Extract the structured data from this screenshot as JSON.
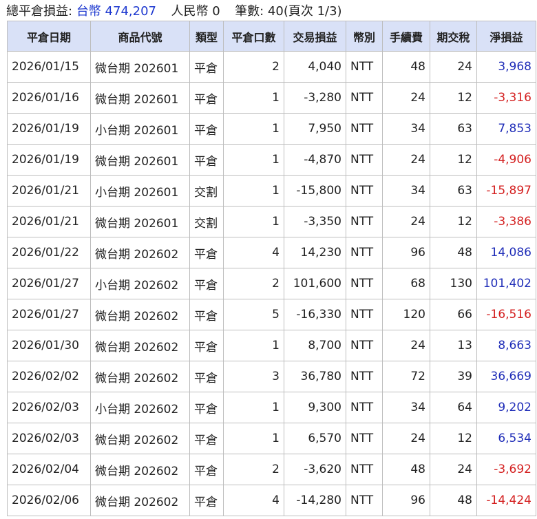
{
  "summary": {
    "label": "總平倉損益:",
    "twd_label": "台幣",
    "twd_value": "474,207",
    "rmb_label": "人民幣",
    "rmb_value": "0",
    "count_label": "筆數:",
    "count_value": "40(頁次 1/3)"
  },
  "colors": {
    "header_bg": "#d9e1f7",
    "positive": "#1f2db8",
    "negative": "#d42020",
    "summary_blue": "#1f3ad0"
  },
  "table": {
    "headers": [
      "平倉日期",
      "商品代號",
      "類型",
      "平倉口數",
      "交易損益",
      "幣別",
      "手續費",
      "期交稅",
      "淨損益"
    ],
    "rows": [
      {
        "date": "2026/01/15",
        "product": "微台期 202601",
        "type": "平倉",
        "qty": "2",
        "pnl": "4,040",
        "currency": "NTT",
        "fee": "48",
        "tax": "24",
        "net": "3,968",
        "sign": "pos"
      },
      {
        "date": "2026/01/16",
        "product": "微台期 202601",
        "type": "平倉",
        "qty": "1",
        "pnl": "-3,280",
        "currency": "NTT",
        "fee": "24",
        "tax": "12",
        "net": "-3,316",
        "sign": "neg"
      },
      {
        "date": "2026/01/19",
        "product": "小台期 202601",
        "type": "平倉",
        "qty": "1",
        "pnl": "7,950",
        "currency": "NTT",
        "fee": "34",
        "tax": "63",
        "net": "7,853",
        "sign": "pos"
      },
      {
        "date": "2026/01/19",
        "product": "微台期 202601",
        "type": "平倉",
        "qty": "1",
        "pnl": "-4,870",
        "currency": "NTT",
        "fee": "24",
        "tax": "12",
        "net": "-4,906",
        "sign": "neg"
      },
      {
        "date": "2026/01/21",
        "product": "小台期 202601",
        "type": "交割",
        "qty": "1",
        "pnl": "-15,800",
        "currency": "NTT",
        "fee": "34",
        "tax": "63",
        "net": "-15,897",
        "sign": "neg"
      },
      {
        "date": "2026/01/21",
        "product": "微台期 202601",
        "type": "交割",
        "qty": "1",
        "pnl": "-3,350",
        "currency": "NTT",
        "fee": "24",
        "tax": "12",
        "net": "-3,386",
        "sign": "neg"
      },
      {
        "date": "2026/01/22",
        "product": "微台期 202602",
        "type": "平倉",
        "qty": "4",
        "pnl": "14,230",
        "currency": "NTT",
        "fee": "96",
        "tax": "48",
        "net": "14,086",
        "sign": "pos"
      },
      {
        "date": "2026/01/27",
        "product": "小台期 202602",
        "type": "平倉",
        "qty": "2",
        "pnl": "101,600",
        "currency": "NTT",
        "fee": "68",
        "tax": "130",
        "net": "101,402",
        "sign": "pos"
      },
      {
        "date": "2026/01/27",
        "product": "微台期 202602",
        "type": "平倉",
        "qty": "5",
        "pnl": "-16,330",
        "currency": "NTT",
        "fee": "120",
        "tax": "66",
        "net": "-16,516",
        "sign": "neg"
      },
      {
        "date": "2026/01/30",
        "product": "微台期 202602",
        "type": "平倉",
        "qty": "1",
        "pnl": "8,700",
        "currency": "NTT",
        "fee": "24",
        "tax": "13",
        "net": "8,663",
        "sign": "pos"
      },
      {
        "date": "2026/02/02",
        "product": "微台期 202602",
        "type": "平倉",
        "qty": "3",
        "pnl": "36,780",
        "currency": "NTT",
        "fee": "72",
        "tax": "39",
        "net": "36,669",
        "sign": "pos"
      },
      {
        "date": "2026/02/03",
        "product": "小台期 202602",
        "type": "平倉",
        "qty": "1",
        "pnl": "9,300",
        "currency": "NTT",
        "fee": "34",
        "tax": "64",
        "net": "9,202",
        "sign": "pos"
      },
      {
        "date": "2026/02/03",
        "product": "微台期 202602",
        "type": "平倉",
        "qty": "1",
        "pnl": "6,570",
        "currency": "NTT",
        "fee": "24",
        "tax": "12",
        "net": "6,534",
        "sign": "pos"
      },
      {
        "date": "2026/02/04",
        "product": "微台期 202602",
        "type": "平倉",
        "qty": "2",
        "pnl": "-3,620",
        "currency": "NTT",
        "fee": "48",
        "tax": "24",
        "net": "-3,692",
        "sign": "neg"
      },
      {
        "date": "2026/02/06",
        "product": "微台期 202602",
        "type": "平倉",
        "qty": "4",
        "pnl": "-14,280",
        "currency": "NTT",
        "fee": "96",
        "tax": "48",
        "net": "-14,424",
        "sign": "neg"
      }
    ]
  }
}
